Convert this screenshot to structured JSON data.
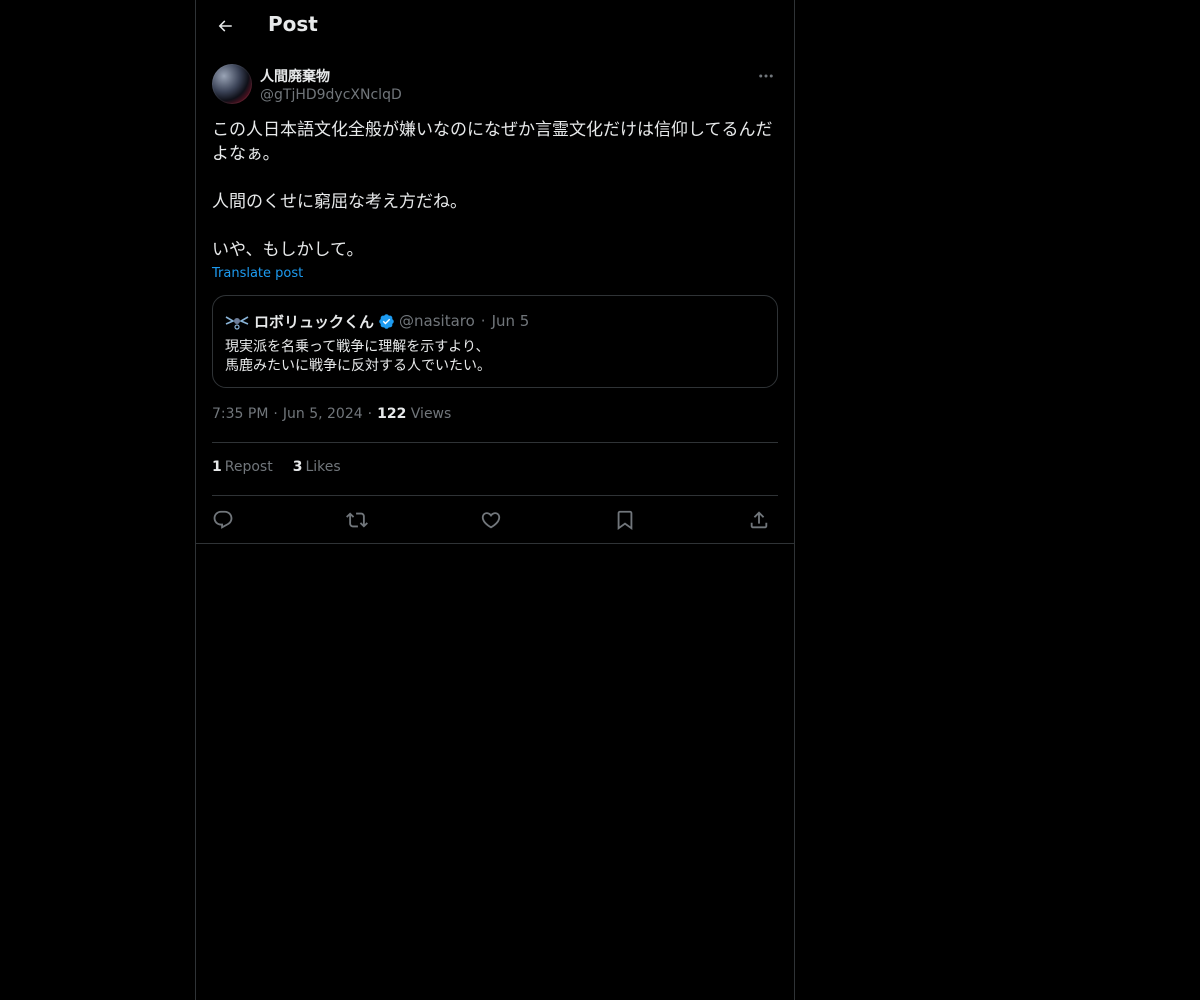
{
  "header": {
    "title": "Post"
  },
  "post": {
    "author": {
      "display_name": "人間廃棄物",
      "handle": "@gTjHD9dycXNclqD"
    },
    "paragraphs": [
      "この人日本語文化全般が嫌いなのになぜか言霊文化だけは信仰してるんだ\nよなぁ。",
      "人間のくせに窮屈な考え方だね。",
      "いや、もしかして。"
    ],
    "translate_label": "Translate post",
    "quote": {
      "display_name": "ロボリュックくん",
      "handle": "@nasitaro",
      "separator": "·",
      "date": "Jun 5",
      "text_line1": "現実派を名乗って戦争に理解を示すより、",
      "text_line2": "馬鹿みたいに戦争に反対する人でいたい。"
    },
    "meta": {
      "time": "7:35 PM",
      "date": "Jun 5, 2024",
      "views_count": "122",
      "views_label": "Views",
      "separator": "·"
    },
    "stats": {
      "reposts_count": "1",
      "reposts_label": "Repost",
      "likes_count": "3",
      "likes_label": "Likes"
    }
  },
  "colors": {
    "background": "#000000",
    "text_primary": "#e7e9ea",
    "text_secondary": "#71767b",
    "link": "#1d9bf0",
    "border": "#2f3336"
  },
  "icons": [
    "back-arrow-icon",
    "more-icon",
    "verified-badge-icon",
    "reply-icon",
    "repost-icon",
    "like-icon",
    "bookmark-icon",
    "share-icon"
  ]
}
